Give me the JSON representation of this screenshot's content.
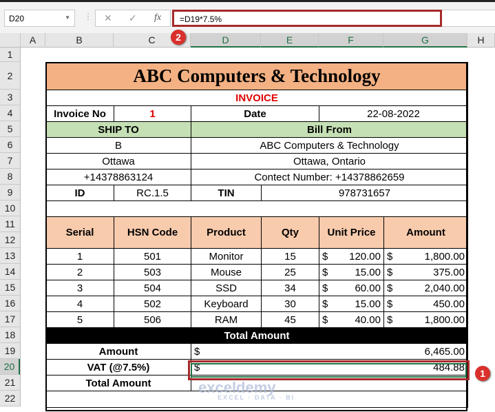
{
  "formula_bar": {
    "name_box": "D20",
    "formula": "=D19*7.5%",
    "cancel": "✕",
    "enter": "✓",
    "fx": "fx"
  },
  "columns": [
    "A",
    "B",
    "C",
    "D",
    "E",
    "F",
    "G",
    "H"
  ],
  "rows": [
    "1",
    "2",
    "3",
    "4",
    "5",
    "6",
    "7",
    "8",
    "9",
    "10",
    "11",
    "12",
    "13",
    "14",
    "15",
    "16",
    "17",
    "18",
    "19",
    "20",
    "21",
    "22"
  ],
  "selected": {
    "column": "D",
    "row": "20"
  },
  "badges": {
    "one": "1",
    "two": "2"
  },
  "invoice": {
    "title": "ABC Computers & Technology",
    "subtitle": "INVOICE",
    "invoice_no_label": "Invoice No",
    "invoice_no": "1",
    "date_label": "Date",
    "date": "22-08-2022",
    "ship_to_label": "SHIP TO",
    "bill_from_label": "Bill From",
    "ship_name": "B",
    "bill_name": "ABC Computers & Technology",
    "ship_city": "Ottawa",
    "bill_city": "Ottawa, Ontario",
    "ship_phone": "+14378863124",
    "bill_phone": "Contect Number: +14378862659",
    "id_label": "ID",
    "id": "RC.1.5",
    "tin_label": "TIN",
    "tin": "978731657",
    "headers": [
      "Serial",
      "HSN Code",
      "Product",
      "Qty",
      "Unit Price",
      "Amount"
    ],
    "items": [
      {
        "serial": "1",
        "hsn": "501",
        "product": "Monitor",
        "qty": "15",
        "price": "120.00",
        "amount": "1,800.00"
      },
      {
        "serial": "2",
        "hsn": "503",
        "product": "Mouse",
        "qty": "25",
        "price": "15.00",
        "amount": "375.00"
      },
      {
        "serial": "3",
        "hsn": "504",
        "product": "SSD",
        "qty": "34",
        "price": "60.00",
        "amount": "2,040.00"
      },
      {
        "serial": "4",
        "hsn": "502",
        "product": "Keyboard",
        "qty": "30",
        "price": "15.00",
        "amount": "450.00"
      },
      {
        "serial": "5",
        "hsn": "506",
        "product": "RAM",
        "qty": "45",
        "price": "40.00",
        "amount": "1,800.00"
      }
    ],
    "currency": "$",
    "total_header": "Total Amount",
    "amount_label": "Amount",
    "amount_value": "6,465.00",
    "vat_label": "VAT (@7.5%)",
    "vat_value": "484.88",
    "total_label": "Total Amount"
  },
  "watermark": {
    "name": "exceldemy",
    "tagline": "EXCEL · DATA · BI"
  }
}
